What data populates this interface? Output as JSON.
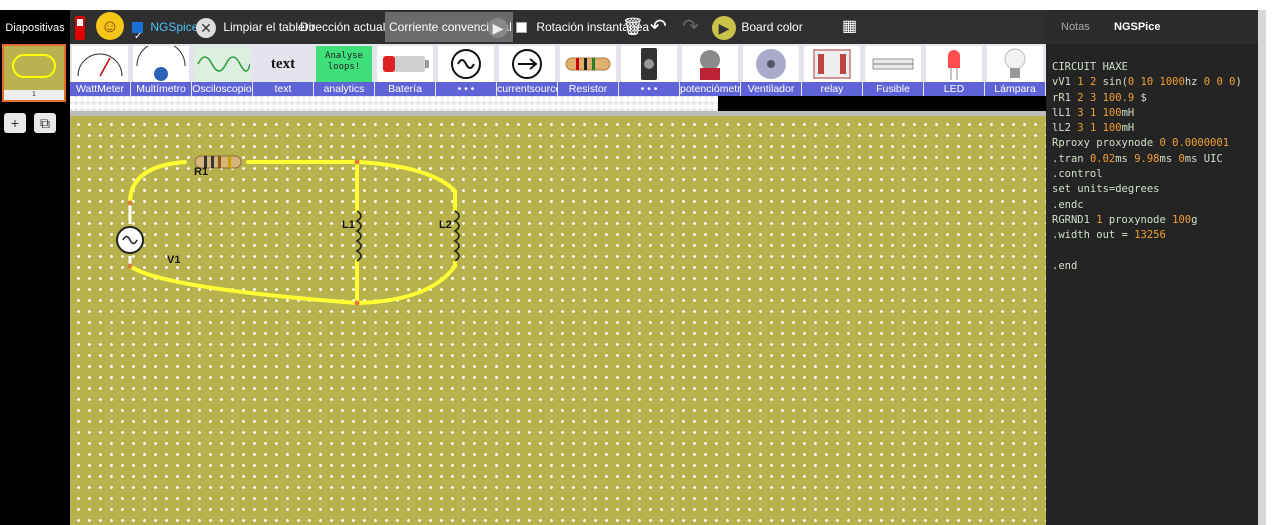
{
  "slides": {
    "title": "Diapositivas",
    "thumb_number": "1",
    "add_label": "+",
    "copy_label": "⧉"
  },
  "toolbar": {
    "power_icon": "power-switch-icon",
    "ngspice_label": "NGSpice",
    "ngspice_checked": true,
    "clear_label": "Limpiar el tablero",
    "direction_label": "Dirección actual:",
    "direction_value": "Corriente convencional",
    "rotation_label": "Rotación instantánea",
    "rotation_checked": false,
    "board_color_label": "Board color"
  },
  "components": [
    {
      "label": "WattMeter",
      "icon": "wattmeter-icon"
    },
    {
      "label": "Multímetro",
      "icon": "multimeter-icon"
    },
    {
      "label": "Osciloscopio",
      "icon": "oscilloscope-icon"
    },
    {
      "label": "text",
      "icon": "text-icon",
      "icon_text": "text"
    },
    {
      "label": "analytics",
      "icon": "analytics-icon",
      "icon_text": "Analyse loops!"
    },
    {
      "label": "Batería",
      "icon": "battery-icon"
    },
    {
      "label": "• • •",
      "icon": "ac-source-icon"
    },
    {
      "label": "currentsource",
      "icon": "current-source-icon"
    },
    {
      "label": "Resistor",
      "icon": "resistor-icon"
    },
    {
      "label": "• • •",
      "icon": "switch-icon"
    },
    {
      "label": "potenciómetro",
      "icon": "potentiometer-icon"
    },
    {
      "label": "Ventilador",
      "icon": "fan-icon"
    },
    {
      "label": "relay",
      "icon": "relay-icon"
    },
    {
      "label": "Fusible",
      "icon": "fuse-icon"
    },
    {
      "label": "LED",
      "icon": "led-icon"
    },
    {
      "label": "Lámpara",
      "icon": "lamp-icon"
    }
  ],
  "circuit": {
    "r1_label": "R1",
    "v1_label": "V1",
    "l1_label": "L1",
    "l2_label": "L2",
    "wire_color": "#ffff33",
    "board_color": "#b7b24c"
  },
  "right_panel": {
    "tabs": [
      "Notas",
      "NGSPice"
    ],
    "active_tab": "NGSPice",
    "code_lines": [
      "CIRCUIT HAXE",
      "vV1 1 2 sin(0 10 1000hz 0 0 0)",
      "rR1 2 3 100.9 $",
      "lL1 3 1 100mH",
      "lL2 3 1 100mH",
      "Rproxy proxynode 0 0.0000001",
      ".tran 0.02ms 9.98ms 0ms UIC",
      ".control",
      "set units=degrees",
      ".endc",
      "RGRND1 1 proxynode 100g",
      ".width out = 13256",
      "",
      ".end"
    ]
  }
}
